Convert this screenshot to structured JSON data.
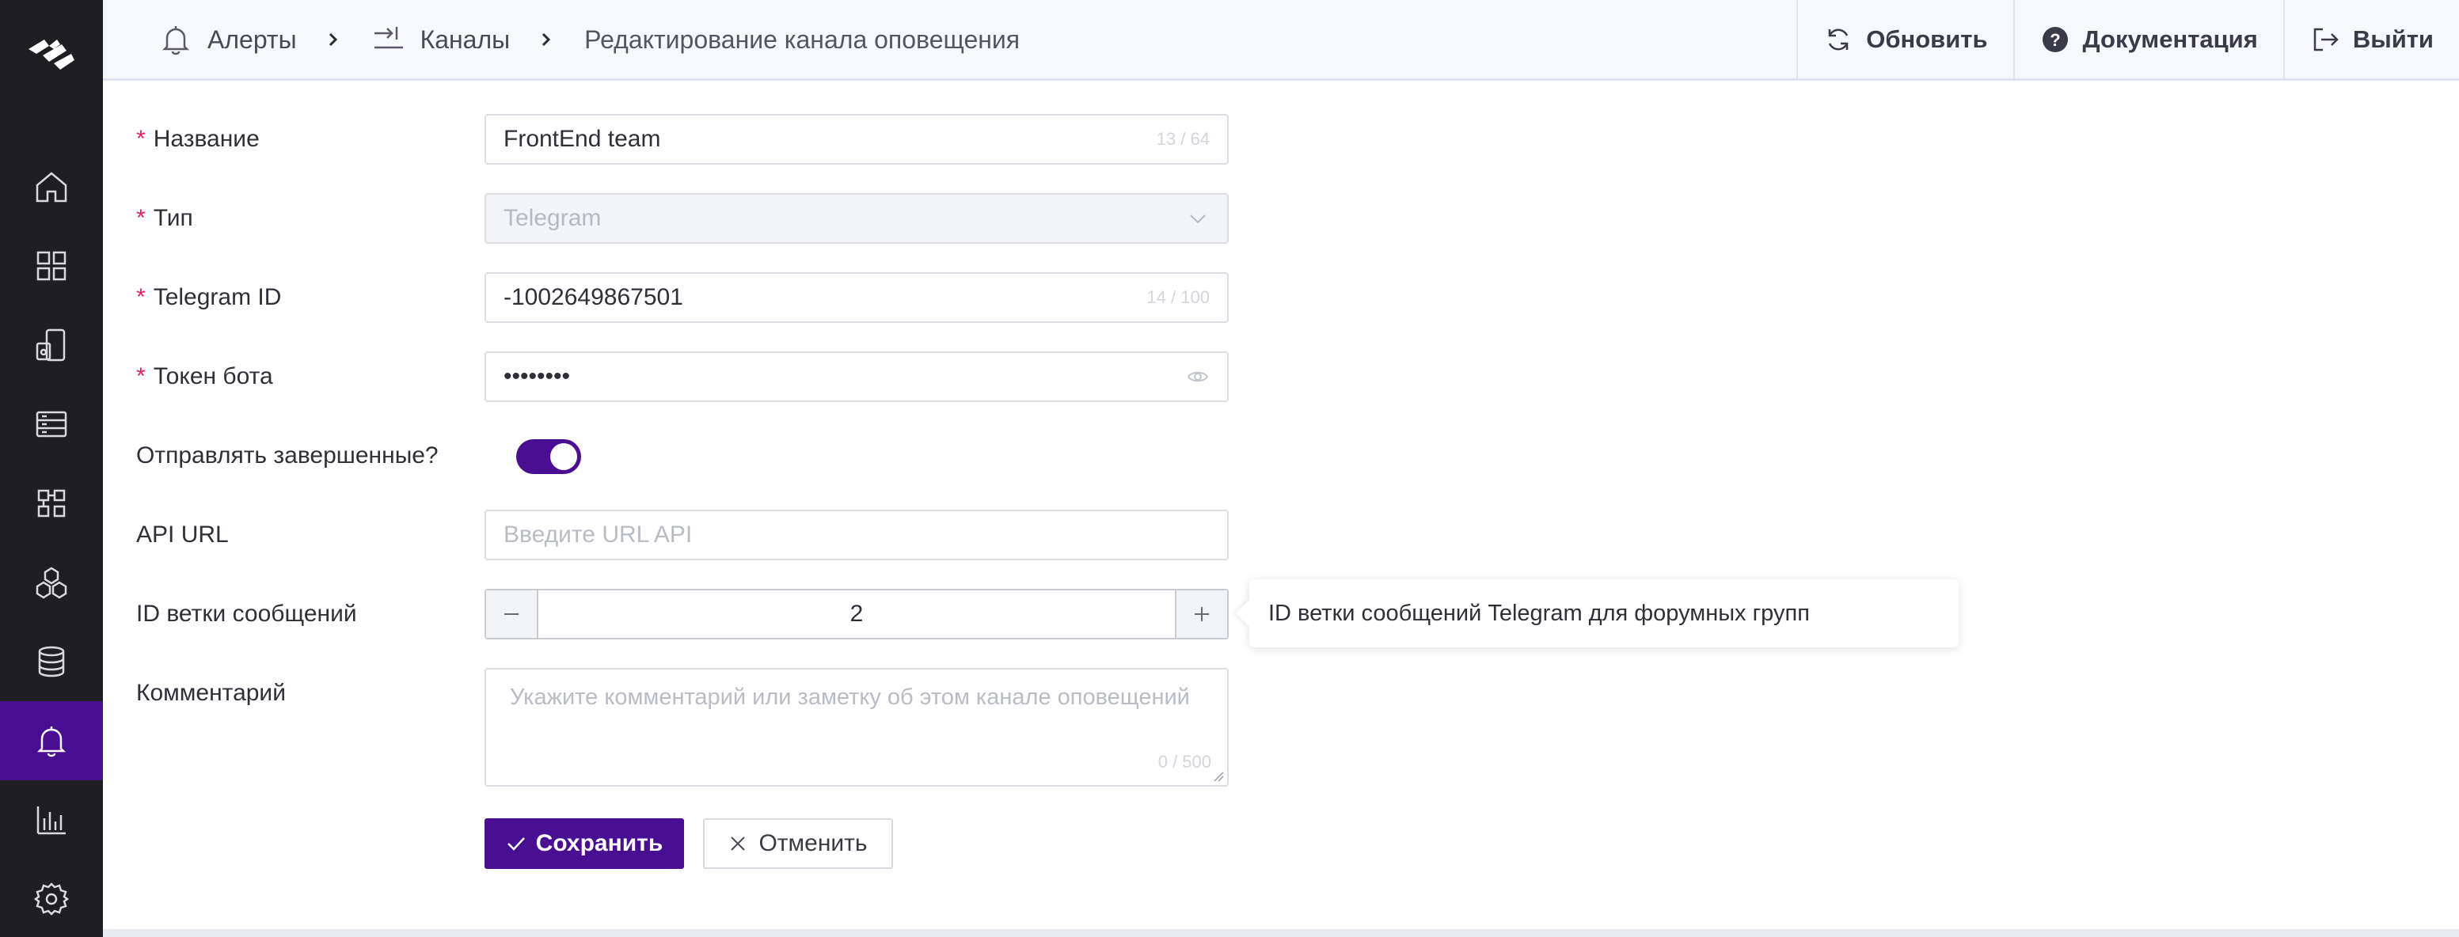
{
  "colors": {
    "sidebar_bg": "#1f1f23",
    "accent": "#4a0e92",
    "required": "#e0245e"
  },
  "sidebar": {
    "logo_icon": "logo-icon",
    "items": [
      {
        "icon": "home-icon",
        "active": false
      },
      {
        "icon": "dashboard-grid-icon",
        "active": false
      },
      {
        "icon": "devices-icon",
        "active": false
      },
      {
        "icon": "list-panel-icon",
        "active": false
      },
      {
        "icon": "apps-icon",
        "active": false
      },
      {
        "icon": "hexagons-icon",
        "active": false
      },
      {
        "icon": "database-icon",
        "active": false
      },
      {
        "icon": "bell-icon",
        "active": true
      },
      {
        "icon": "bar-chart-icon",
        "active": false
      },
      {
        "icon": "gear-icon",
        "active": false
      }
    ]
  },
  "header": {
    "breadcrumbs": [
      {
        "label": "Алерты",
        "icon": "bell-icon"
      },
      {
        "label": "Каналы",
        "icon": "channels-icon"
      },
      {
        "label": "Редактирование канала оповещения"
      }
    ],
    "actions": {
      "refresh": "Обновить",
      "docs": "Документация",
      "logout": "Выйти"
    }
  },
  "form": {
    "name": {
      "label": "Название",
      "value": "FrontEnd team",
      "count": "13 / 64"
    },
    "type": {
      "label": "Тип",
      "value": "Telegram"
    },
    "telegram_id": {
      "label": "Telegram ID",
      "value": "-1002649867501",
      "count": "14 / 100"
    },
    "bot_token": {
      "label": "Токен бота",
      "value": "••••••••"
    },
    "send_resolved": {
      "label": "Отправлять завершенные?",
      "checked": true
    },
    "api_url": {
      "label": "API URL",
      "placeholder": "Введите URL API"
    },
    "thread_id": {
      "label": "ID ветки сообщений",
      "value": "2",
      "tooltip": "ID ветки сообщений Telegram для форумных групп"
    },
    "comment": {
      "label": "Комментарий",
      "placeholder": "Укажите комментарий или заметку об этом канале оповещений",
      "count": "0 / 500"
    }
  },
  "buttons": {
    "save": "Сохранить",
    "cancel": "Отменить"
  }
}
